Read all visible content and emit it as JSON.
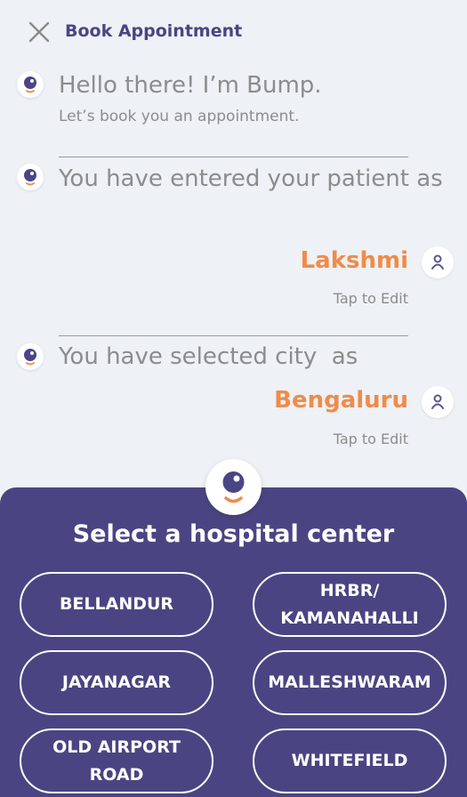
{
  "header": {
    "title": "Book Appointment",
    "close_icon": "close-icon"
  },
  "chat": {
    "greeting": "Hello there! I’m Bump.",
    "greeting_sub": "Let’s book you an appointment.",
    "patient_prompt": "You have entered your patient as",
    "patient_answer": "Lakshmi",
    "city_prompt": "You have selected city  as",
    "city_answer": "Bengaluru",
    "tap_to_edit": "Tap to Edit"
  },
  "panel": {
    "title": "Select a hospital center",
    "options": [
      "BELLANDUR",
      "HRBR/ KAMANAHALLI",
      "JAYANAGAR",
      "MALLESHWARAM",
      "OLD AIRPORT ROAD",
      "WHITEFIELD"
    ]
  },
  "colors": {
    "background": "#eef1f5",
    "title": "#4a4585",
    "accent": "#f08b4a",
    "panel": "#4a4582"
  }
}
